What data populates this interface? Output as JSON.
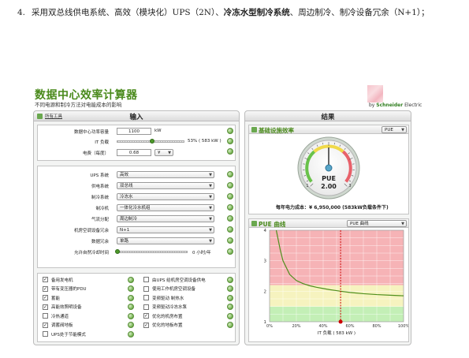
{
  "document": {
    "item_number": "4.",
    "text_before_bold": "采用双总线供电系统、高效（模块化）UPS（2N）、",
    "bold_text": "冷冻水型制冷系统",
    "text_after_bold": "、周边制冷、制冷设备冗余（N+1）；"
  },
  "app": {
    "title": "数据中心效率计算器",
    "subtitle": "不同电源和制冷方法对电能成本的影响",
    "brand_by": "by",
    "brand_name": "Schneider",
    "brand_suffix": "Electric"
  },
  "input_panel": {
    "title": "输入",
    "tools_link": "所有工具",
    "capacity": {
      "label": "数据中心功率容量",
      "value": "1100",
      "unit": "kW"
    },
    "it_load": {
      "label": "IT 负载",
      "percent_text": "53% ( 583 kW )",
      "level": 0.53
    },
    "electricity": {
      "label": "电费（每度）",
      "value": "0.68",
      "unit": "¥"
    },
    "systems": [
      {
        "label": "UPS 系统",
        "value": "高效"
      },
      {
        "label": "供电系统",
        "value": "双总线"
      },
      {
        "label": "制冷系统",
        "value": "冷冻水"
      },
      {
        "label": "制冷机",
        "value": "一体化冷水机组"
      },
      {
        "label": "气流分配",
        "value": "周边制冷"
      },
      {
        "label": "机房空调设备冗余",
        "value": "N+1"
      },
      {
        "label": "数据冗余",
        "value": "单路"
      }
    ],
    "free_cooling": {
      "label": "允许自然冷却时间",
      "value_text": "0 小时/年",
      "level": 0.0
    },
    "checkboxes_left": [
      {
        "label": "备用发电机",
        "checked": true
      },
      {
        "label": "带有变压器的PDU",
        "checked": true
      },
      {
        "label": "蓄能",
        "checked": true
      },
      {
        "label": "高能效照明设备",
        "checked": true
      },
      {
        "label": "冷热通道",
        "checked": false
      },
      {
        "label": "调蓄阀地板",
        "checked": true
      },
      {
        "label": "UPS处于节能模式",
        "checked": false
      }
    ],
    "checkboxes_right": [
      {
        "label": "由UPS 给机房空调设备供电",
        "checked": false
      },
      {
        "label": "使用工作机房空调设备",
        "checked": false
      },
      {
        "label": "变频驱动 制热水",
        "checked": false
      },
      {
        "label": "变频驱动冷冻水泵",
        "checked": false
      },
      {
        "label": "优化的机房布置",
        "checked": true
      },
      {
        "label": "优化的地板布置",
        "checked": true
      }
    ]
  },
  "result_panel": {
    "title": "结果",
    "efficiency_section": "基础设施效率",
    "pue_select": "PUE",
    "gauge": {
      "label": "PUE",
      "value": "2.00",
      "min_label": "1",
      "max_label": "3",
      "value_num": 2.0,
      "range": [
        1,
        3
      ]
    },
    "cost_label": "每年电力成本：",
    "cost_value": "¥ 6,950,000 (583kW负载条件下)",
    "curve_section": "PUE 曲线",
    "curve_select": "PUE 曲线",
    "colors": {
      "red_zone": "#f6b3b6",
      "yellow_zone": "#f6f3bf",
      "green_zone": "#c3efb6",
      "curve": "#4f8f1d",
      "marker": "#cc0000",
      "accent": "#4a8a1c"
    }
  },
  "chart_data": {
    "type": "line",
    "title": "PUE 曲线",
    "xlabel": "IT 负载 ( 583 kW )",
    "ylabel": "",
    "xlim": [
      0,
      100
    ],
    "ylim": [
      1,
      4
    ],
    "x_ticks": [
      "0%",
      "20%",
      "40%",
      "60%",
      "80%",
      "100%"
    ],
    "y_ticks": [
      "1",
      "2",
      "3",
      "4"
    ],
    "series": [
      {
        "x": [
          5,
          8,
          10,
          15,
          20,
          25,
          30,
          35,
          40,
          45,
          50,
          53,
          60,
          70,
          80,
          90,
          100
        ],
        "y": [
          4.0,
          3.35,
          3.0,
          2.55,
          2.35,
          2.25,
          2.18,
          2.13,
          2.09,
          2.05,
          2.02,
          2.0,
          1.96,
          1.92,
          1.89,
          1.87,
          1.85
        ]
      }
    ],
    "marker_x": 53,
    "bands": [
      {
        "from": 1,
        "to": 1.5,
        "color": "green"
      },
      {
        "from": 1.5,
        "to": 2.2,
        "color": "yellow"
      },
      {
        "from": 2.2,
        "to": 4,
        "color": "red"
      }
    ],
    "grid": true
  }
}
